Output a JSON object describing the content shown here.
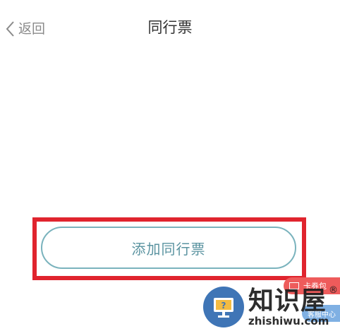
{
  "header": {
    "back_label": "返回",
    "title": "同行票"
  },
  "main": {
    "add_button_label": "添加同行票"
  },
  "floating": {
    "coupon_label": "卡券包",
    "service_label": "客服中心"
  },
  "watermark": {
    "title": "知识屋",
    "url": "zhishiwu.com",
    "registered": "®"
  },
  "colors": {
    "highlight": "#e0242e",
    "button_border": "#7ab3bd",
    "button_text": "#5a93a0",
    "coupon_bg": "#ee5b5b",
    "logo_bg": "#2f6ab0"
  },
  "icons": {
    "back": "chevron-left-icon",
    "coupon": "ticket-icon",
    "logo": "monitor-question-icon"
  }
}
